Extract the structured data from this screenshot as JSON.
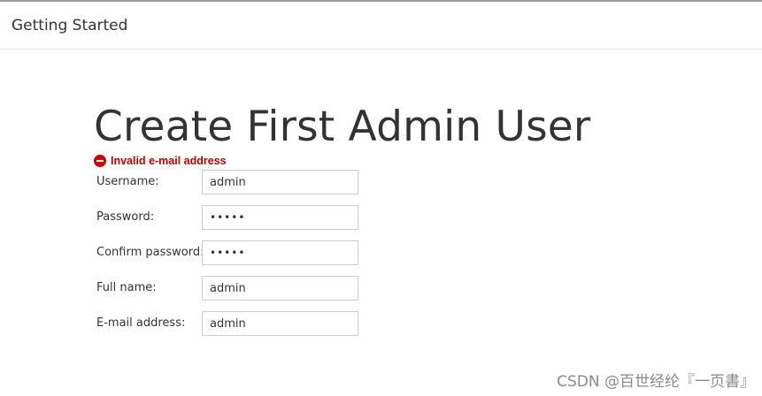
{
  "header": {
    "title": "Getting Started"
  },
  "main": {
    "title": "Create First Admin User",
    "error": {
      "icon": "error-icon",
      "text": "Invalid e-mail address"
    },
    "form": {
      "username": {
        "label": "Username:",
        "value": "admin"
      },
      "password": {
        "label": "Password:",
        "value": "admin"
      },
      "confirm_password": {
        "label": "Confirm password:",
        "value": "admin"
      },
      "full_name": {
        "label": "Full name:",
        "value": "admin"
      },
      "email": {
        "label": "E-mail address:",
        "value": "admin"
      }
    }
  },
  "watermark": {
    "text": "CSDN @百世经纶『一页書』"
  },
  "colors": {
    "error": "#c00000",
    "text": "#333333",
    "input_border": "#cccccc"
  }
}
